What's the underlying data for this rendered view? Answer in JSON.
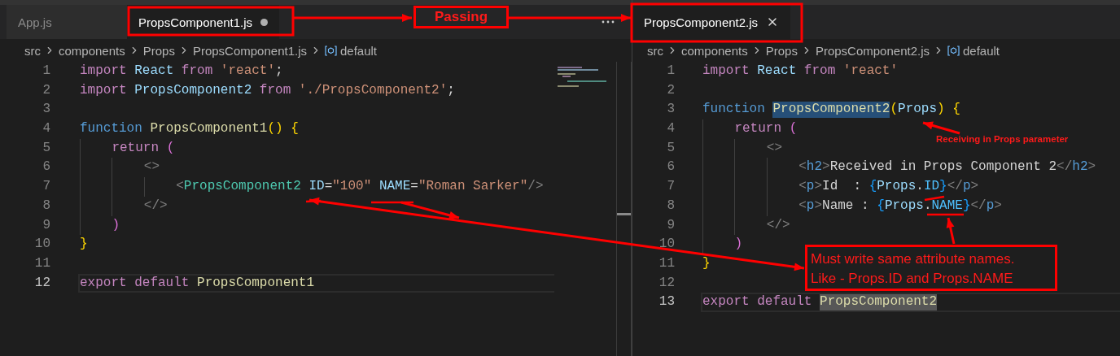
{
  "left_pane": {
    "tabs": [
      {
        "label": "App.js",
        "selected": false,
        "dirty": false
      },
      {
        "label": "PropsComponent1.js",
        "selected": true,
        "dirty": true
      }
    ],
    "breadcrumb": [
      {
        "label": "src",
        "kind": "folder"
      },
      {
        "label": "components",
        "kind": "folder"
      },
      {
        "label": "Props",
        "kind": "folder"
      },
      {
        "label": "PropsComponent1.js",
        "kind": "file"
      },
      {
        "label": "default",
        "kind": "symbol"
      }
    ],
    "lines": [
      {
        "number": "1",
        "current": false,
        "tokens": [
          {
            "text": "import ",
            "kind": "kw"
          },
          {
            "text": "React ",
            "kind": "var"
          },
          {
            "text": "from ",
            "kind": "kw"
          },
          {
            "text": "'react'",
            "kind": "str"
          },
          {
            "text": ";",
            "kind": "punct"
          }
        ]
      },
      {
        "number": "2",
        "current": false,
        "tokens": [
          {
            "text": "import ",
            "kind": "kw"
          },
          {
            "text": "PropsComponent2 ",
            "kind": "var"
          },
          {
            "text": "from ",
            "kind": "kw"
          },
          {
            "text": "'./PropsComponent2'",
            "kind": "str"
          },
          {
            "text": ";",
            "kind": "punct"
          }
        ]
      },
      {
        "number": "3",
        "current": false
      },
      {
        "number": "4",
        "current": false,
        "tokens": [
          {
            "text": "function ",
            "kind": "storage"
          },
          {
            "text": "PropsComponent1",
            "kind": "fn"
          },
          {
            "text": "()",
            "kind": "br1"
          },
          {
            "text": " {",
            "kind": "br1"
          }
        ]
      },
      {
        "number": "5",
        "current": false,
        "tokens": [
          {
            "text": "    return ",
            "kind": "kw"
          },
          {
            "text": "(",
            "kind": "br2"
          }
        ]
      },
      {
        "number": "6",
        "current": false,
        "tokens": [
          {
            "text": "        <>",
            "kind": "tagp"
          }
        ]
      },
      {
        "number": "7",
        "current": false,
        "tokens": [
          {
            "text": "            <",
            "kind": "tagp"
          },
          {
            "text": "PropsComponent2 ",
            "kind": "comp"
          },
          {
            "text": "ID",
            "kind": "attr"
          },
          {
            "text": "=",
            "kind": "punct"
          },
          {
            "text": "\"100\" ",
            "kind": "str"
          },
          {
            "text": "NAME",
            "kind": "attr"
          },
          {
            "text": "=",
            "kind": "punct"
          },
          {
            "text": "\"Roman Sarker\"",
            "kind": "str"
          },
          {
            "text": "/>",
            "kind": "tagp"
          }
        ]
      },
      {
        "number": "8",
        "current": false,
        "tokens": [
          {
            "text": "        </>",
            "kind": "tagp"
          }
        ]
      },
      {
        "number": "9",
        "current": false,
        "tokens": [
          {
            "text": "    )",
            "kind": "br2"
          }
        ]
      },
      {
        "number": "10",
        "current": false,
        "tokens": [
          {
            "text": "}",
            "kind": "br1"
          }
        ]
      },
      {
        "number": "11",
        "current": false
      },
      {
        "number": "12",
        "current": true,
        "tokens": [
          {
            "text": "export default ",
            "kind": "kw"
          },
          {
            "text": "PropsComponent1",
            "kind": "fn"
          }
        ]
      }
    ]
  },
  "right_pane": {
    "tabs": [
      {
        "label": "PropsComponent2.js",
        "selected": true,
        "dirty": false
      }
    ],
    "breadcrumb": [
      {
        "label": "src",
        "kind": "folder"
      },
      {
        "label": "components",
        "kind": "folder"
      },
      {
        "label": "Props",
        "kind": "folder"
      },
      {
        "label": "PropsComponent2.js",
        "kind": "file"
      },
      {
        "label": "default",
        "kind": "symbol"
      }
    ],
    "lines": [
      {
        "number": "1",
        "current": false,
        "tokens": [
          {
            "text": "import ",
            "kind": "kw"
          },
          {
            "text": "React ",
            "kind": "var"
          },
          {
            "text": "from ",
            "kind": "kw"
          },
          {
            "text": "'react'",
            "kind": "str"
          }
        ]
      },
      {
        "number": "2",
        "current": false
      },
      {
        "number": "3",
        "current": false,
        "tokens": [
          {
            "text": "function ",
            "kind": "storage"
          },
          {
            "text": "PropsComponent2",
            "kind": "fn",
            "selected": true
          },
          {
            "text": "(",
            "kind": "br1"
          },
          {
            "text": "Props",
            "kind": "var"
          },
          {
            "text": ")",
            "kind": "br1"
          },
          {
            "text": " {",
            "kind": "br1"
          }
        ]
      },
      {
        "number": "4",
        "current": false,
        "tokens": [
          {
            "text": "    return ",
            "kind": "kw"
          },
          {
            "text": "(",
            "kind": "br2"
          }
        ]
      },
      {
        "number": "5",
        "current": false,
        "tokens": [
          {
            "text": "        <>",
            "kind": "tagp"
          }
        ]
      },
      {
        "number": "6",
        "current": false,
        "tokens": [
          {
            "text": "            <",
            "kind": "tagp"
          },
          {
            "text": "h2",
            "kind": "tag"
          },
          {
            "text": ">",
            "kind": "tagp"
          },
          {
            "text": "Received in Props Component 2",
            "kind": "text"
          },
          {
            "text": "</",
            "kind": "tagp"
          },
          {
            "text": "h2",
            "kind": "tag"
          },
          {
            "text": ">",
            "kind": "tagp"
          }
        ]
      },
      {
        "number": "7",
        "current": false,
        "tokens": [
          {
            "text": "            <",
            "kind": "tagp"
          },
          {
            "text": "p",
            "kind": "tag"
          },
          {
            "text": ">",
            "kind": "tagp"
          },
          {
            "text": "Id  : ",
            "kind": "text"
          },
          {
            "text": "{",
            "kind": "br3"
          },
          {
            "text": "Props",
            "kind": "var"
          },
          {
            "text": ".",
            "kind": "punct"
          },
          {
            "text": "ID",
            "kind": "const"
          },
          {
            "text": "}",
            "kind": "br3"
          },
          {
            "text": "</",
            "kind": "tagp"
          },
          {
            "text": "p",
            "kind": "tag"
          },
          {
            "text": ">",
            "kind": "tagp"
          }
        ]
      },
      {
        "number": "8",
        "current": false,
        "tokens": [
          {
            "text": "            <",
            "kind": "tagp"
          },
          {
            "text": "p",
            "kind": "tag"
          },
          {
            "text": ">",
            "kind": "tagp"
          },
          {
            "text": "Name : ",
            "kind": "text"
          },
          {
            "text": "{",
            "kind": "br3"
          },
          {
            "text": "Props",
            "kind": "var"
          },
          {
            "text": ".",
            "kind": "punct"
          },
          {
            "text": "NAME",
            "kind": "const"
          },
          {
            "text": "}",
            "kind": "br3"
          },
          {
            "text": "</",
            "kind": "tagp"
          },
          {
            "text": "p",
            "kind": "tag"
          },
          {
            "text": ">",
            "kind": "tagp"
          }
        ]
      },
      {
        "number": "9",
        "current": false,
        "tokens": [
          {
            "text": "        </>",
            "kind": "tagp"
          }
        ]
      },
      {
        "number": "10",
        "current": false,
        "tokens": [
          {
            "text": "    )",
            "kind": "br2"
          }
        ]
      },
      {
        "number": "11",
        "current": false,
        "tokens": [
          {
            "text": "}",
            "kind": "br1"
          }
        ]
      },
      {
        "number": "12",
        "current": false
      },
      {
        "number": "13",
        "current": true,
        "tokens": [
          {
            "text": "export default ",
            "kind": "kw"
          },
          {
            "text": "PropsComponent2",
            "kind": "fn",
            "occurrence": true
          }
        ]
      }
    ]
  },
  "annotations": {
    "passing_label": "Passing",
    "receiving_note": "Receiving in Props parameter",
    "note": [
      "Must write same attribute names.",
      "Like - Props.ID and Props.NAME"
    ]
  }
}
